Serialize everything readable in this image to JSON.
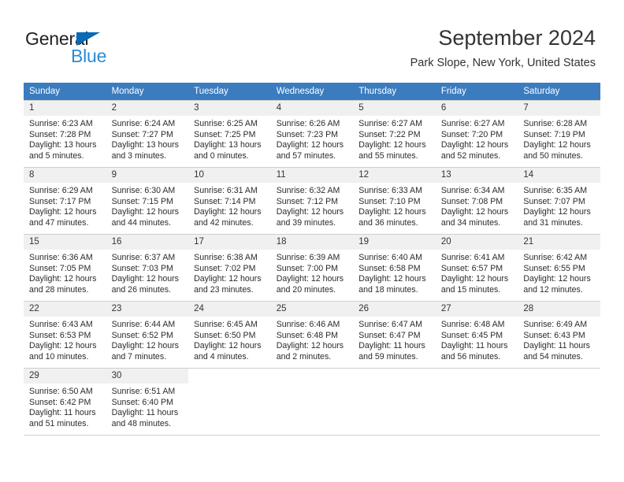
{
  "brand": {
    "name_top": "General",
    "name_bottom": "Blue",
    "flag_color": "#0a6ab5",
    "blue_color": "#2b8bd4"
  },
  "header": {
    "title": "September 2024",
    "subtitle": "Park Slope, New York, United States",
    "header_bg_color": "#3b7cbf",
    "daynum_bg_color": "#f0f0f0"
  },
  "weekdays": [
    "Sunday",
    "Monday",
    "Tuesday",
    "Wednesday",
    "Thursday",
    "Friday",
    "Saturday"
  ],
  "labels": {
    "sunrise": "Sunrise:",
    "sunset": "Sunset:",
    "daylight": "Daylight:"
  },
  "weeks": [
    [
      {
        "day": "1",
        "sunrise": "Sunrise: 6:23 AM",
        "sunset": "Sunset: 7:28 PM",
        "daylight_line1": "Daylight: 13 hours",
        "daylight_line2": "and 5 minutes."
      },
      {
        "day": "2",
        "sunrise": "Sunrise: 6:24 AM",
        "sunset": "Sunset: 7:27 PM",
        "daylight_line1": "Daylight: 13 hours",
        "daylight_line2": "and 3 minutes."
      },
      {
        "day": "3",
        "sunrise": "Sunrise: 6:25 AM",
        "sunset": "Sunset: 7:25 PM",
        "daylight_line1": "Daylight: 13 hours",
        "daylight_line2": "and 0 minutes."
      },
      {
        "day": "4",
        "sunrise": "Sunrise: 6:26 AM",
        "sunset": "Sunset: 7:23 PM",
        "daylight_line1": "Daylight: 12 hours",
        "daylight_line2": "and 57 minutes."
      },
      {
        "day": "5",
        "sunrise": "Sunrise: 6:27 AM",
        "sunset": "Sunset: 7:22 PM",
        "daylight_line1": "Daylight: 12 hours",
        "daylight_line2": "and 55 minutes."
      },
      {
        "day": "6",
        "sunrise": "Sunrise: 6:27 AM",
        "sunset": "Sunset: 7:20 PM",
        "daylight_line1": "Daylight: 12 hours",
        "daylight_line2": "and 52 minutes."
      },
      {
        "day": "7",
        "sunrise": "Sunrise: 6:28 AM",
        "sunset": "Sunset: 7:19 PM",
        "daylight_line1": "Daylight: 12 hours",
        "daylight_line2": "and 50 minutes."
      }
    ],
    [
      {
        "day": "8",
        "sunrise": "Sunrise: 6:29 AM",
        "sunset": "Sunset: 7:17 PM",
        "daylight_line1": "Daylight: 12 hours",
        "daylight_line2": "and 47 minutes."
      },
      {
        "day": "9",
        "sunrise": "Sunrise: 6:30 AM",
        "sunset": "Sunset: 7:15 PM",
        "daylight_line1": "Daylight: 12 hours",
        "daylight_line2": "and 44 minutes."
      },
      {
        "day": "10",
        "sunrise": "Sunrise: 6:31 AM",
        "sunset": "Sunset: 7:14 PM",
        "daylight_line1": "Daylight: 12 hours",
        "daylight_line2": "and 42 minutes."
      },
      {
        "day": "11",
        "sunrise": "Sunrise: 6:32 AM",
        "sunset": "Sunset: 7:12 PM",
        "daylight_line1": "Daylight: 12 hours",
        "daylight_line2": "and 39 minutes."
      },
      {
        "day": "12",
        "sunrise": "Sunrise: 6:33 AM",
        "sunset": "Sunset: 7:10 PM",
        "daylight_line1": "Daylight: 12 hours",
        "daylight_line2": "and 36 minutes."
      },
      {
        "day": "13",
        "sunrise": "Sunrise: 6:34 AM",
        "sunset": "Sunset: 7:08 PM",
        "daylight_line1": "Daylight: 12 hours",
        "daylight_line2": "and 34 minutes."
      },
      {
        "day": "14",
        "sunrise": "Sunrise: 6:35 AM",
        "sunset": "Sunset: 7:07 PM",
        "daylight_line1": "Daylight: 12 hours",
        "daylight_line2": "and 31 minutes."
      }
    ],
    [
      {
        "day": "15",
        "sunrise": "Sunrise: 6:36 AM",
        "sunset": "Sunset: 7:05 PM",
        "daylight_line1": "Daylight: 12 hours",
        "daylight_line2": "and 28 minutes."
      },
      {
        "day": "16",
        "sunrise": "Sunrise: 6:37 AM",
        "sunset": "Sunset: 7:03 PM",
        "daylight_line1": "Daylight: 12 hours",
        "daylight_line2": "and 26 minutes."
      },
      {
        "day": "17",
        "sunrise": "Sunrise: 6:38 AM",
        "sunset": "Sunset: 7:02 PM",
        "daylight_line1": "Daylight: 12 hours",
        "daylight_line2": "and 23 minutes."
      },
      {
        "day": "18",
        "sunrise": "Sunrise: 6:39 AM",
        "sunset": "Sunset: 7:00 PM",
        "daylight_line1": "Daylight: 12 hours",
        "daylight_line2": "and 20 minutes."
      },
      {
        "day": "19",
        "sunrise": "Sunrise: 6:40 AM",
        "sunset": "Sunset: 6:58 PM",
        "daylight_line1": "Daylight: 12 hours",
        "daylight_line2": "and 18 minutes."
      },
      {
        "day": "20",
        "sunrise": "Sunrise: 6:41 AM",
        "sunset": "Sunset: 6:57 PM",
        "daylight_line1": "Daylight: 12 hours",
        "daylight_line2": "and 15 minutes."
      },
      {
        "day": "21",
        "sunrise": "Sunrise: 6:42 AM",
        "sunset": "Sunset: 6:55 PM",
        "daylight_line1": "Daylight: 12 hours",
        "daylight_line2": "and 12 minutes."
      }
    ],
    [
      {
        "day": "22",
        "sunrise": "Sunrise: 6:43 AM",
        "sunset": "Sunset: 6:53 PM",
        "daylight_line1": "Daylight: 12 hours",
        "daylight_line2": "and 10 minutes."
      },
      {
        "day": "23",
        "sunrise": "Sunrise: 6:44 AM",
        "sunset": "Sunset: 6:52 PM",
        "daylight_line1": "Daylight: 12 hours",
        "daylight_line2": "and 7 minutes."
      },
      {
        "day": "24",
        "sunrise": "Sunrise: 6:45 AM",
        "sunset": "Sunset: 6:50 PM",
        "daylight_line1": "Daylight: 12 hours",
        "daylight_line2": "and 4 minutes."
      },
      {
        "day": "25",
        "sunrise": "Sunrise: 6:46 AM",
        "sunset": "Sunset: 6:48 PM",
        "daylight_line1": "Daylight: 12 hours",
        "daylight_line2": "and 2 minutes."
      },
      {
        "day": "26",
        "sunrise": "Sunrise: 6:47 AM",
        "sunset": "Sunset: 6:47 PM",
        "daylight_line1": "Daylight: 11 hours",
        "daylight_line2": "and 59 minutes."
      },
      {
        "day": "27",
        "sunrise": "Sunrise: 6:48 AM",
        "sunset": "Sunset: 6:45 PM",
        "daylight_line1": "Daylight: 11 hours",
        "daylight_line2": "and 56 minutes."
      },
      {
        "day": "28",
        "sunrise": "Sunrise: 6:49 AM",
        "sunset": "Sunset: 6:43 PM",
        "daylight_line1": "Daylight: 11 hours",
        "daylight_line2": "and 54 minutes."
      }
    ],
    [
      {
        "day": "29",
        "sunrise": "Sunrise: 6:50 AM",
        "sunset": "Sunset: 6:42 PM",
        "daylight_line1": "Daylight: 11 hours",
        "daylight_line2": "and 51 minutes."
      },
      {
        "day": "30",
        "sunrise": "Sunrise: 6:51 AM",
        "sunset": "Sunset: 6:40 PM",
        "daylight_line1": "Daylight: 11 hours",
        "daylight_line2": "and 48 minutes."
      },
      {
        "day": "",
        "sunrise": "",
        "sunset": "",
        "daylight_line1": "",
        "daylight_line2": ""
      },
      {
        "day": "",
        "sunrise": "",
        "sunset": "",
        "daylight_line1": "",
        "daylight_line2": ""
      },
      {
        "day": "",
        "sunrise": "",
        "sunset": "",
        "daylight_line1": "",
        "daylight_line2": ""
      },
      {
        "day": "",
        "sunrise": "",
        "sunset": "",
        "daylight_line1": "",
        "daylight_line2": ""
      },
      {
        "day": "",
        "sunrise": "",
        "sunset": "",
        "daylight_line1": "",
        "daylight_line2": ""
      }
    ]
  ]
}
